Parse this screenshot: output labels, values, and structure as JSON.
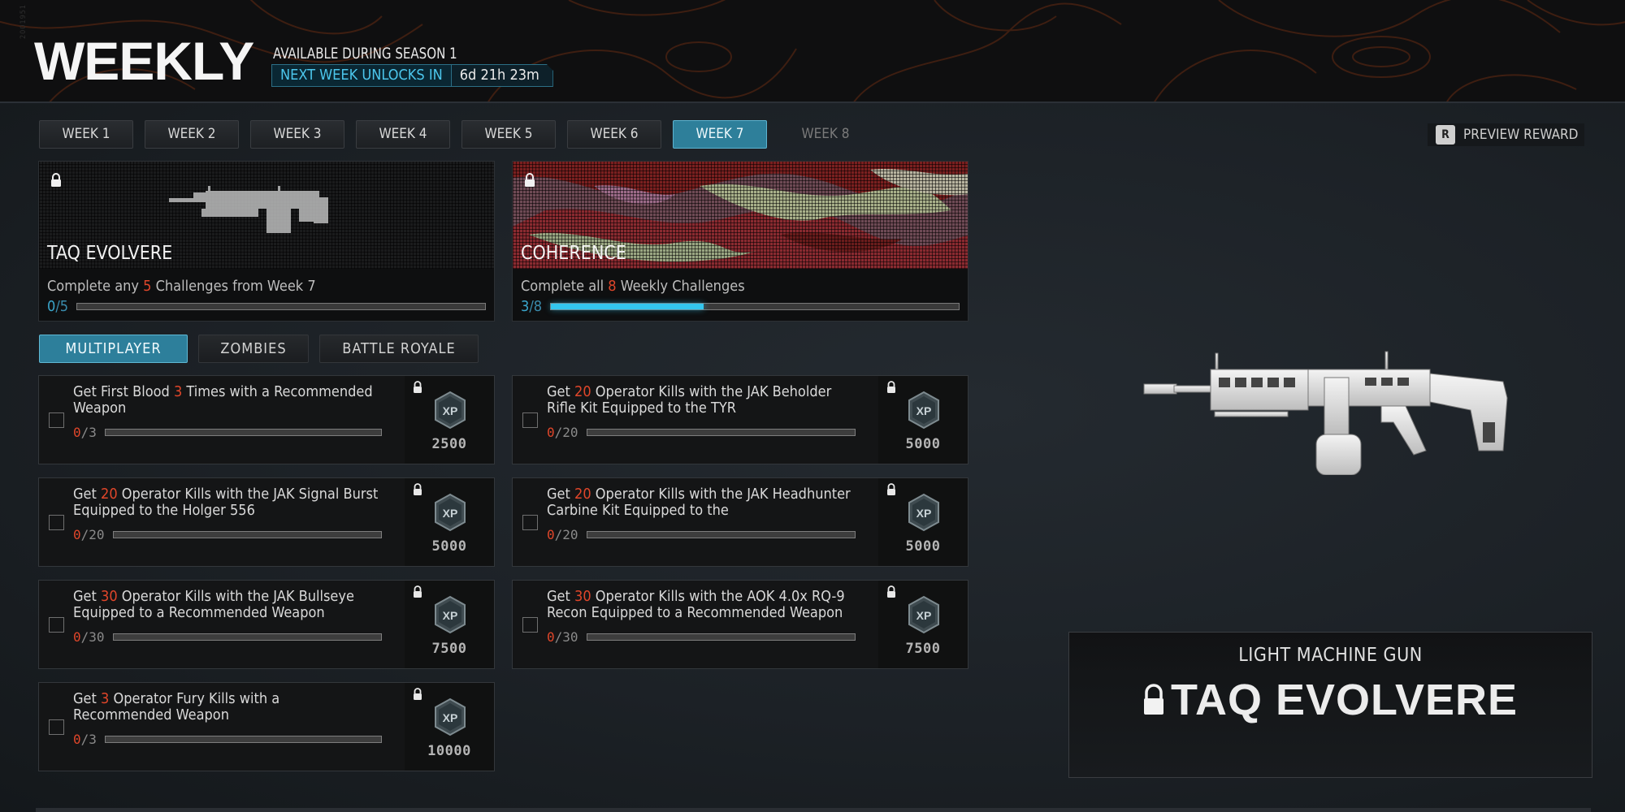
{
  "header": {
    "vertical_id": "2001951",
    "title": "WEEKLY",
    "season": "AVAILABLE DURING SEASON 1",
    "unlock_label": "NEXT WEEK UNLOCKS IN",
    "unlock_time": "6d 21h 23m"
  },
  "weeks": [
    {
      "label": "WEEK 1",
      "state": "normal"
    },
    {
      "label": "WEEK 2",
      "state": "normal"
    },
    {
      "label": "WEEK 3",
      "state": "normal"
    },
    {
      "label": "WEEK 4",
      "state": "normal"
    },
    {
      "label": "WEEK 5",
      "state": "normal"
    },
    {
      "label": "WEEK 6",
      "state": "normal"
    },
    {
      "label": "WEEK 7",
      "state": "active"
    },
    {
      "label": "WEEK 8",
      "state": "disabled"
    }
  ],
  "preview_reward": {
    "key": "R",
    "label": "PREVIEW REWARD"
  },
  "reward_cards": [
    {
      "name": "TAQ EVOLVERE",
      "desc_prefix": "Complete any ",
      "desc_highlight": "5",
      "desc_suffix": " Challenges from Week 7",
      "current": "0",
      "total": "5",
      "progress": 0
    },
    {
      "name": "COHERENCE",
      "desc_prefix": "Complete all ",
      "desc_highlight": "8",
      "desc_suffix": " Weekly Challenges",
      "current": "3",
      "total": "8",
      "progress": 0.375
    }
  ],
  "modes": [
    {
      "label": "MULTIPLAYER",
      "active": true
    },
    {
      "label": "ZOMBIES",
      "active": false
    },
    {
      "label": "BATTLE ROYALE",
      "active": false
    }
  ],
  "challenges": [
    {
      "pre": "Get First Blood ",
      "hl": "3",
      "post": " Times with a Recommended Weapon",
      "current": "0",
      "total": "3",
      "xp": "2500"
    },
    {
      "pre": "Get ",
      "hl": "20",
      "post": " Operator Kills with the JAK Beholder Rifle Kit Equipped to the TYR",
      "current": "0",
      "total": "20",
      "xp": "5000"
    },
    {
      "pre": "Get ",
      "hl": "20",
      "post": " Operator Kills with the JAK Signal Burst Equipped to the Holger 556",
      "current": "0",
      "total": "20",
      "xp": "5000"
    },
    {
      "pre": "Get ",
      "hl": "20",
      "post": " Operator Kills with the JAK Headhunter Carbine Kit Equipped to the",
      "current": "0",
      "total": "20",
      "xp": "5000"
    },
    {
      "pre": "Get ",
      "hl": "30",
      "post": " Operator Kills with the JAK Bullseye Equipped to a Recommended Weapon",
      "current": "0",
      "total": "30",
      "xp": "7500"
    },
    {
      "pre": "Get ",
      "hl": "30",
      "post": " Operator Kills with the AOK 4.0x RQ-9 Recon Equipped to a Recommended Weapon",
      "current": "0",
      "total": "30",
      "xp": "7500"
    },
    {
      "pre": "Get ",
      "hl": "3",
      "post": " Operator Fury Kills with a Recommended Weapon",
      "current": "0",
      "total": "3",
      "xp": "10000"
    }
  ],
  "weapon_panel": {
    "type": "LIGHT MACHINE GUN",
    "name": "TAQ EVOLVERE"
  },
  "colors": {
    "accent": "#2e7f9a",
    "highlight": "#e0462a",
    "progress": "#34c6ee"
  }
}
